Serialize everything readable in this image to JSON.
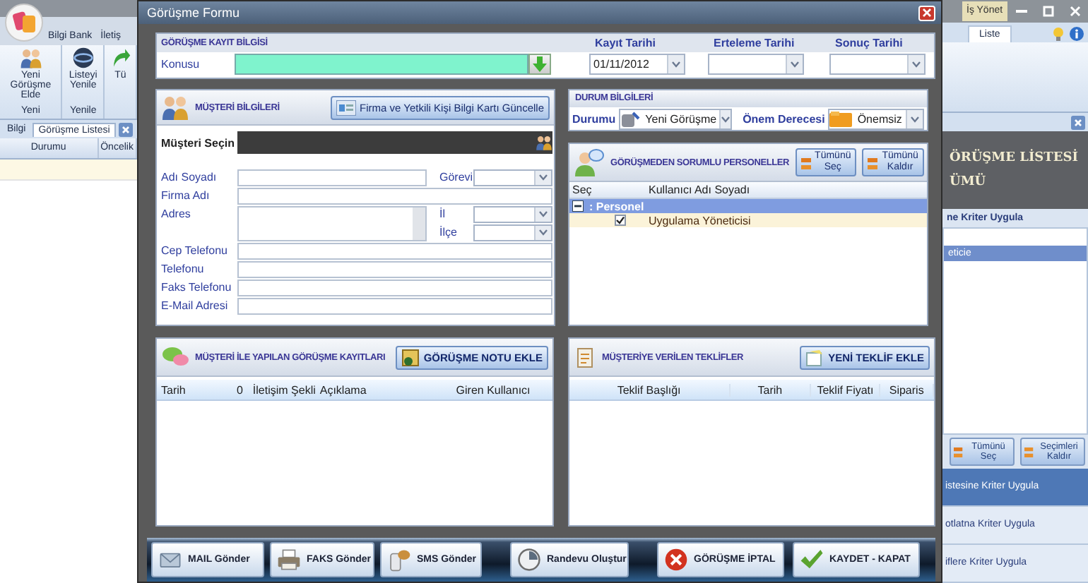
{
  "app": {
    "ribbon_tabs": [
      "Bilgi Bank",
      "İletiş"
    ],
    "ribbon_groups": [
      {
        "button": "Yeni Görüşme Elde",
        "label": "Yeni"
      },
      {
        "button": "Listeyi Yenile",
        "label": "Yenile"
      },
      {
        "button": "Tü"
      }
    ],
    "doc_tabs": [
      {
        "label": "Bilgi",
        "selected": false
      },
      {
        "label": "Görüşme Listesi",
        "selected": true
      }
    ],
    "grid_columns": [
      "Durumu",
      "Öncelik"
    ],
    "title": "İş Yönet",
    "right_tab": "Liste",
    "side_title": "ÖRÜŞME LİSTESİ",
    "side_subtitle": "ÜMÜ",
    "side_header": "ne Kriter Uygula",
    "side_list": [
      {
        "label": "eticie",
        "selected": true
      }
    ],
    "side_buttons": [
      "Tümünü Seç",
      "Seçimleri Kaldır"
    ],
    "side_nav": [
      {
        "label": "istesine Kriter Uygula",
        "selected": true
      },
      {
        "label": "otlatna Kriter Uygula",
        "selected": false
      },
      {
        "label": "iflere Kriter Uygula",
        "selected": false
      }
    ]
  },
  "dialog": {
    "title": "Görüşme Formu",
    "record": {
      "title": "GÖRÜŞME KAYIT BİLGİSİ",
      "subject_label": "Konusu",
      "dates": [
        {
          "label": "Kayıt Tarihi",
          "value": "01/11/2012"
        },
        {
          "label": "Erteleme Tarihi"
        },
        {
          "label": "Sonuç Tarihi"
        }
      ]
    },
    "customer": {
      "title": "MÜŞTERİ BİLGİLERİ",
      "update_button": "Firma ve Yetkili Kişi Bilgi Kartı Güncelle",
      "picker_label": "Müşteri Seçin",
      "name_label": "Adı Soyadı",
      "role_label": "Görevi",
      "company_label": "Firma Adı",
      "address_label": "Adres",
      "city_label": "İl",
      "district_label": "İlçe",
      "contact_labels": [
        "Cep Telefonu",
        "Telefonu",
        "Faks Telefonu",
        "E-Mail Adresi"
      ]
    },
    "status": {
      "title": "DURUM BİLGİLERİ",
      "status_label": "Durumu",
      "status_value": "Yeni Görüşme",
      "priority_label": "Önem Derecesi",
      "priority_value": "Önemsiz"
    },
    "staff": {
      "title": "GÖRÜŞMEDEN SORUMLU PERSONELLER",
      "buttons": [
        "Tümünü Seç",
        "Tümünü Kaldır"
      ],
      "columns": [
        "Seç",
        "Kullanıcı Adı Soyadı"
      ],
      "groups": [
        {
          "label": ": Personel",
          "expanded": true,
          "rows": [
            {
              "name": "Uygulama Yöneticisi",
              "checked": true
            }
          ]
        }
      ]
    },
    "records": {
      "title": "MÜŞTERİ İLE YAPILAN GÖRÜŞME KAYITLARI",
      "add_button": "GÖRÜŞME NOTU EKLE",
      "columns": [
        "Tarih",
        "0",
        "İletişim Şekli",
        "Açıklama",
        "Giren Kullanıcı"
      ]
    },
    "offers": {
      "title": "MÜŞTERİYE VERİLEN TEKLİFLER",
      "add_button": "YENİ TEKLİF EKLE",
      "columns": [
        "Teklif Başlığı",
        "Tarih",
        "Teklif Fiyatı",
        "Siparis"
      ]
    },
    "actions": [
      "MAIL Gönder",
      "FAKS Gönder",
      "SMS Gönder",
      "Randevu Oluştur",
      "GÖRÜŞME İPTAL",
      "KAYDET - KAPAT"
    ]
  }
}
